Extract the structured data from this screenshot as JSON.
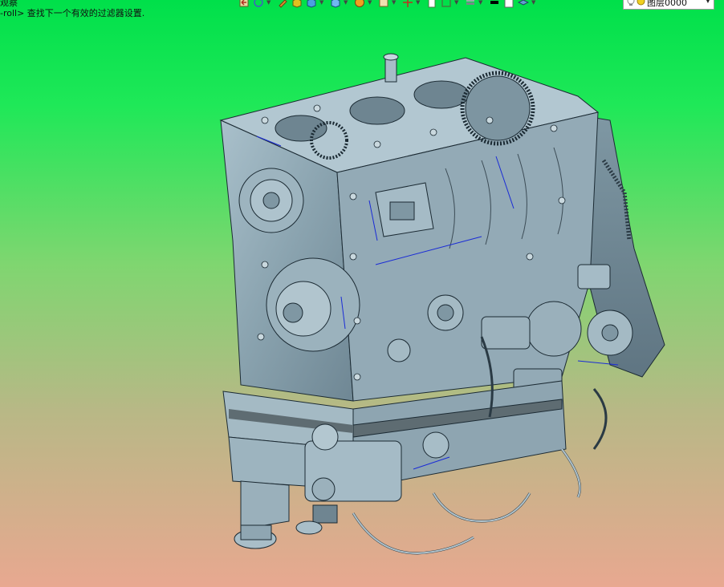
{
  "status": {
    "line1": "观察",
    "line2": "-roll> 查找下一个有效的过滤器设置."
  },
  "toolbar": {
    "icons": [
      "view-back-icon",
      "rotate-icon",
      "pen-icon",
      "layer-cube-icon",
      "cube-icon",
      "solid-cube-icon",
      "render-sphere-icon",
      "box-icon",
      "axis-icon",
      "page-icon",
      "frame-icon",
      "display-stack-icon",
      "color-swatch-icon",
      "white-swatch-icon",
      "layer-stack-icon"
    ],
    "colors": {
      "swatch_black": "#000000",
      "swatch_white": "#ffffff"
    }
  },
  "layer": {
    "value": "图层0000"
  },
  "viewport": {
    "background_top": "#00e04a",
    "background_bottom": "#e8a890",
    "model_color": "#8fa8b4"
  }
}
